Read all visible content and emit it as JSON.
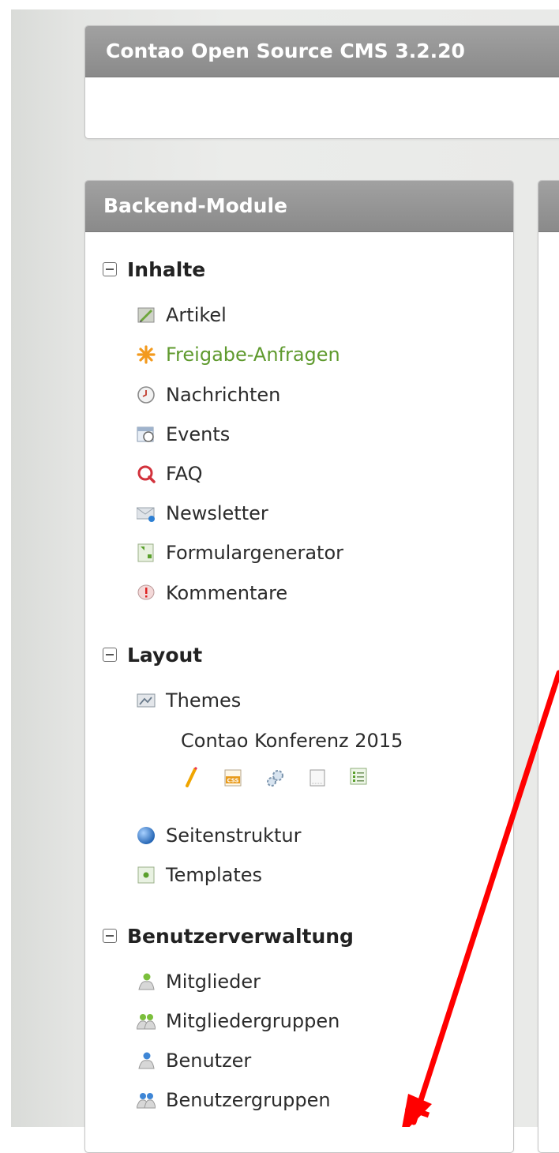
{
  "app": {
    "title": "Contao Open Source CMS 3.2.20"
  },
  "nav": {
    "title": "Backend-Module",
    "groups": [
      {
        "label": "Inhalte",
        "items": [
          {
            "label": "Artikel",
            "icon": "article-icon"
          },
          {
            "label": "Freigabe-Anfragen",
            "icon": "asterisk-icon",
            "active": true
          },
          {
            "label": "Nachrichten",
            "icon": "clock-icon"
          },
          {
            "label": "Events",
            "icon": "calendar-icon"
          },
          {
            "label": "FAQ",
            "icon": "faq-icon"
          },
          {
            "label": "Newsletter",
            "icon": "envelope-icon"
          },
          {
            "label": "Formulargenerator",
            "icon": "form-icon"
          },
          {
            "label": "Kommentare",
            "icon": "comment-icon"
          }
        ]
      },
      {
        "label": "Layout",
        "items": [
          {
            "label": "Themes",
            "icon": "themes-icon"
          },
          {
            "label": "Contao Konferenz 2015",
            "icon": ""
          },
          {
            "label": "Seitenstruktur",
            "icon": "globe-icon"
          },
          {
            "label": "Templates",
            "icon": "templates-icon"
          }
        ],
        "theme_tools": [
          "edit-icon",
          "css-icon",
          "modules-icon",
          "layout-icon",
          "image-sizes-icon"
        ]
      },
      {
        "label": "Benutzerverwaltung",
        "items": [
          {
            "label": "Mitglieder",
            "icon": "member-icon"
          },
          {
            "label": "Mitgliedergruppen",
            "icon": "member-group-icon"
          },
          {
            "label": "Benutzer",
            "icon": "user-icon"
          },
          {
            "label": "Benutzergruppen",
            "icon": "user-group-icon"
          }
        ]
      }
    ]
  },
  "colors": {
    "header_bg": "#8f8f8f",
    "active_link": "#5f9a2e",
    "annotation_arrow": "#ff0000"
  }
}
